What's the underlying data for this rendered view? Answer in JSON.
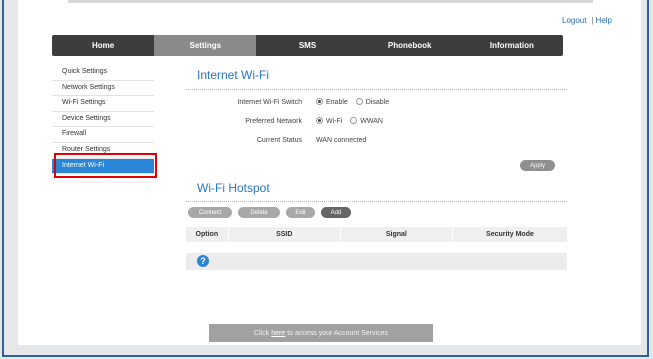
{
  "header": {
    "logout_label": "Logout",
    "separator": "|",
    "help_label": "Help"
  },
  "nav": {
    "tabs": [
      "Home",
      "Settings",
      "SMS",
      "Phonebook",
      "Information"
    ],
    "active": "Settings"
  },
  "sidebar": {
    "items": [
      "Quick Settings",
      "Network Settings",
      "Wi-Fi Settings",
      "Device Settings",
      "Firewall",
      "Router Settings",
      "Internet Wi-Fi"
    ],
    "active": "Internet Wi-Fi"
  },
  "internet_wifi": {
    "title": "Internet Wi-Fi",
    "switch_label": "Internet Wi-Fi Switch",
    "switch_options": [
      "Enable",
      "Disable"
    ],
    "switch_selected": "Enable",
    "network_label": "Preferred Network",
    "network_options": [
      "Wi-Fi",
      "WWAN"
    ],
    "network_selected": "Wi-Fi",
    "status_label": "Current Status",
    "status_value": "WAN connected",
    "apply_label": "Apply"
  },
  "hotspot": {
    "title": "Wi-Fi Hotspot",
    "buttons": [
      "Connect",
      "Delete",
      "Edit",
      "Add"
    ],
    "columns": [
      "Option",
      "SSID",
      "Signal",
      "Security Mode"
    ]
  },
  "footer": {
    "prefix": "Click",
    "link": "here",
    "suffix": "to access your Account Services"
  },
  "colors": {
    "accent": "#2c86d8",
    "title_blue": "#2a76c0",
    "highlight_red": "#e30000",
    "nav_bg": "#3d3d3d"
  },
  "icons": {
    "help": "question-circle-icon"
  }
}
